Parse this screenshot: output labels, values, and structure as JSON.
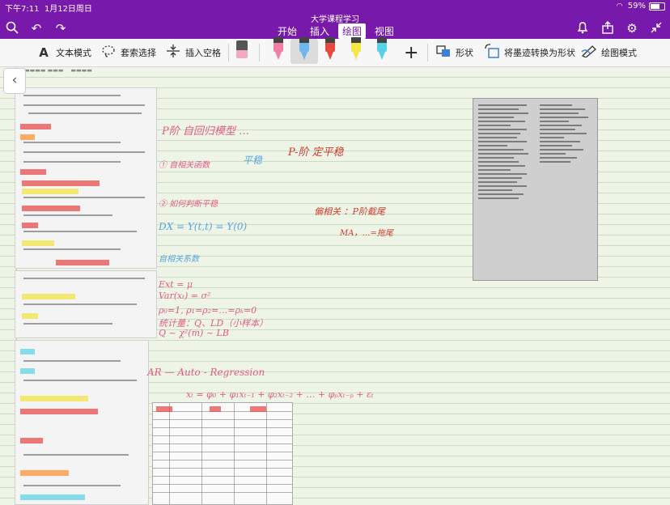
{
  "status": {
    "time": "下午7:11",
    "date": "1月12日周日",
    "battery": "59%"
  },
  "app": {
    "title": "大学课程学习"
  },
  "tabs": [
    {
      "label": "开始"
    },
    {
      "label": "插入"
    },
    {
      "label": "绘图",
      "active": true
    },
    {
      "label": "视图"
    }
  ],
  "toolbar": {
    "text_mode": "文本模式",
    "lasso": "套索选择",
    "insert_space": "插入空格",
    "shapes": "形状",
    "ink_to_shape": "将墨迹转换为形状",
    "draw_mode": "绘图模式",
    "pens": [
      {
        "name": "pink-pen",
        "color": "#f07fa6"
      },
      {
        "name": "blue-pen",
        "color": "#6fb7ef"
      },
      {
        "name": "red-pen",
        "color": "#e54a3f"
      },
      {
        "name": "yellow-highlighter",
        "color": "#f7e64a"
      },
      {
        "name": "cyan-highlighter",
        "color": "#59d2e8"
      },
      {
        "name": "orange-highlighter",
        "color": "#f08030"
      }
    ]
  },
  "notes": {
    "line1": "P阶 自回归模型 …",
    "line2": "P-阶  定平稳",
    "ar": "AR — Auto - Regression",
    "formula": "xₜ = φ₀ + φ₁xₜ₋₁ + φ₂xₜ₋₂ + … + φₚxₜ₋ₚ + εₜ",
    "ex": "Ext = μ",
    "var": "Var(xₜ) = σ²",
    "acf": "ρ₀=1, ρ₁=ρ₂=…=ρₖ=0",
    "ld": "统计量：Q、LD（小样本）",
    "chi": "Q ~ χ²(m) ~ LB",
    "pacf": "偏相关 ：P阶截尾",
    "ma": "MA，…=拖尾"
  }
}
